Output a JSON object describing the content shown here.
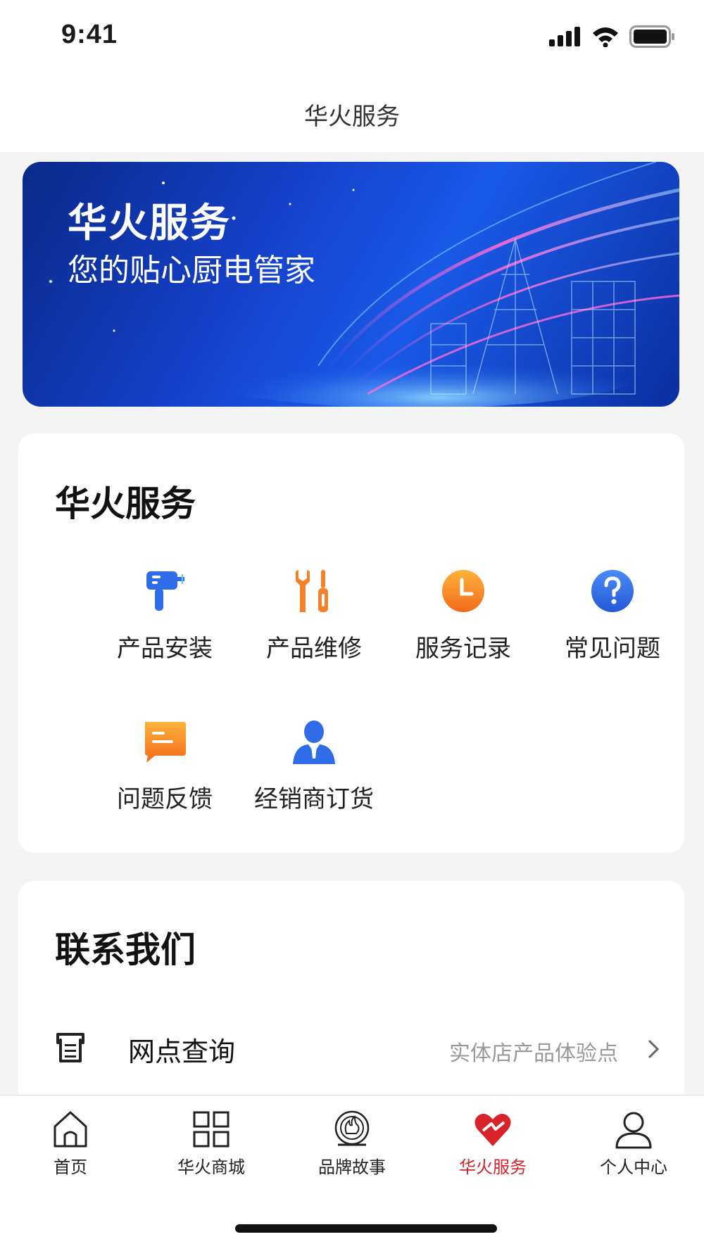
{
  "status_bar": {
    "time": "9:41"
  },
  "header": {
    "title": "华火服务"
  },
  "banner": {
    "title": "华火服务",
    "subtitle": "您的贴心厨电管家"
  },
  "services": {
    "title": "华火服务",
    "items": [
      {
        "label": "产品安装",
        "icon": "drill-icon"
      },
      {
        "label": "产品维修",
        "icon": "wrench-screwdriver-icon"
      },
      {
        "label": "服务记录",
        "icon": "clock-icon"
      },
      {
        "label": "常见问题",
        "icon": "question-icon"
      },
      {
        "label": "问题反馈",
        "icon": "message-icon"
      },
      {
        "label": "经销商订货",
        "icon": "person-icon"
      }
    ]
  },
  "contact": {
    "title": "联系我们",
    "rows": [
      {
        "label": "网点查询",
        "description": "实体店产品体验点"
      }
    ]
  },
  "tab_bar": {
    "items": [
      {
        "label": "首页",
        "icon": "home-icon",
        "active": false
      },
      {
        "label": "华火商城",
        "icon": "grid-icon",
        "active": false
      },
      {
        "label": "品牌故事",
        "icon": "brand-logo-icon",
        "active": false
      },
      {
        "label": "华火服务",
        "icon": "heart-icon",
        "active": true
      },
      {
        "label": "个人中心",
        "icon": "user-icon",
        "active": false
      }
    ]
  },
  "colors": {
    "accent": "#d8232a",
    "blue": "#2f6de8",
    "orange": "#f5822a"
  }
}
